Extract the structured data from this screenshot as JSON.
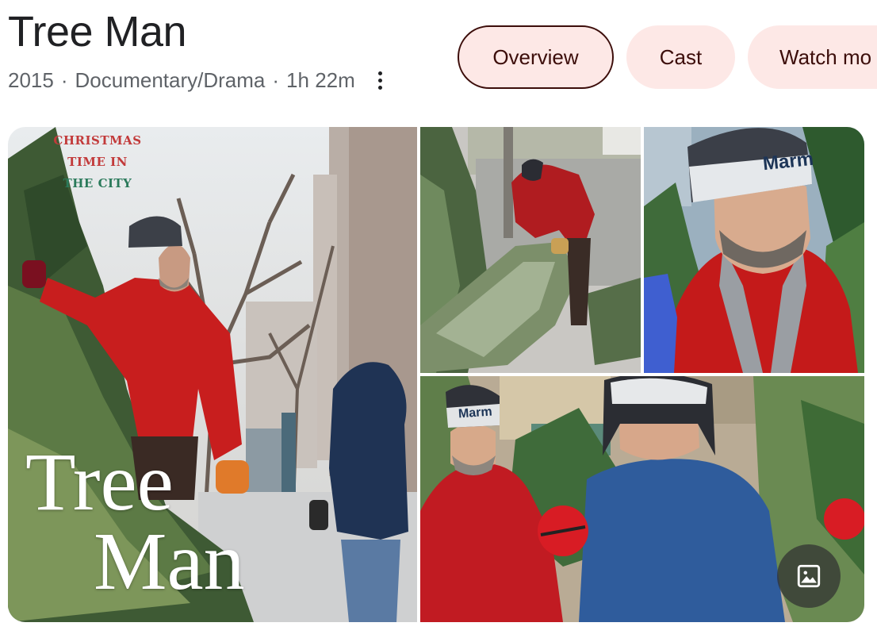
{
  "title": "Tree Man",
  "meta": {
    "year": "2015",
    "genre": "Documentary/Drama",
    "runtime": "1h 22m",
    "separator": "·",
    "more_icon": "more-vert-icon"
  },
  "tabs": [
    {
      "label": "Overview",
      "active": true
    },
    {
      "label": "Cast",
      "active": false
    },
    {
      "label": "Watch mo",
      "active": false
    }
  ],
  "gallery": {
    "poster": {
      "tagline": [
        "CHRISTMAS",
        "TIME IN",
        "THE CITY"
      ],
      "title_line1": "Tree",
      "title_line2": "Man"
    },
    "hat_text_1": "Marm",
    "hat_text_2": "Marm",
    "image_button_icon": "image-icon"
  },
  "colors": {
    "chip_bg": "#fde8e6",
    "chip_text": "#3c0d0a",
    "title_text": "#202124",
    "meta_text": "#5f6368"
  }
}
